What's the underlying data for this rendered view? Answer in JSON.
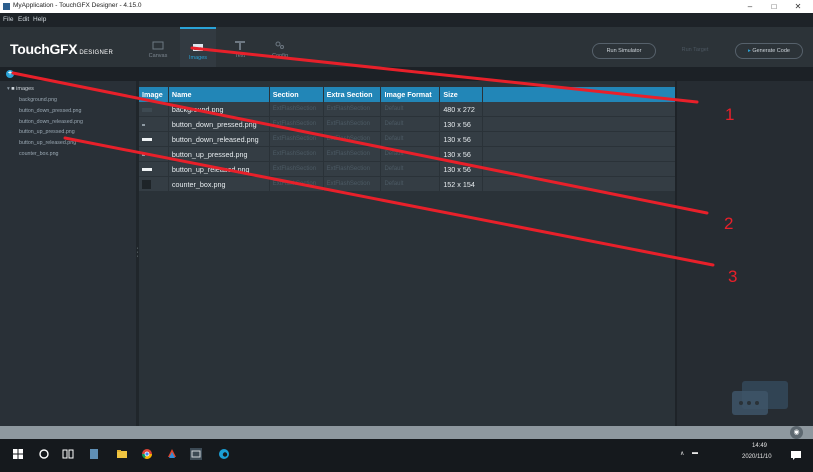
{
  "window": {
    "title": "MyApplication - TouchGFX Designer - 4.15.0",
    "controls": [
      "–",
      "□",
      "✕"
    ]
  },
  "menu": [
    "File",
    "Edit",
    "Help"
  ],
  "header": {
    "logo_main": "TouchGFX",
    "logo_sub": "DESIGNER",
    "tabs": [
      {
        "label": "Canvas",
        "icon": "canvas-icon"
      },
      {
        "label": "Images",
        "icon": "image-icon"
      },
      {
        "label": "Text",
        "icon": "text-icon"
      },
      {
        "label": "Config",
        "icon": "config-icon"
      }
    ],
    "run_simulator": "Run Simulator",
    "run_target": "Run Target",
    "generate_code": "Generate Code"
  },
  "sidebar": {
    "root": "images",
    "items": [
      "background.png",
      "button_down_pressed.png",
      "button_down_released.png",
      "button_up_pressed.png",
      "button_up_released.png",
      "counter_box.png"
    ]
  },
  "table": {
    "headers": [
      "Image",
      "Name",
      "Section",
      "Extra Section",
      "Image Format",
      "Size"
    ],
    "rows": [
      {
        "thumb": "bg",
        "name": "background.png",
        "section": "ExtFlashSection",
        "extra": "ExtFlashSection",
        "format": "Default",
        "size": "480 x 272"
      },
      {
        "thumb": "small",
        "name": "button_down_pressed.png",
        "section": "ExtFlashSection",
        "extra": "ExtFlashSection",
        "format": "Default",
        "size": "130 x 56"
      },
      {
        "thumb": "bar",
        "name": "button_down_released.png",
        "section": "ExtFlashSection",
        "extra": "ExtFlashSection",
        "format": "Default",
        "size": "130 x 56"
      },
      {
        "thumb": "small",
        "name": "button_up_pressed.png",
        "section": "ExtFlashSection",
        "extra": "ExtFlashSection",
        "format": "Default",
        "size": "130 x 56"
      },
      {
        "thumb": "bar",
        "name": "button_up_released.png",
        "section": "ExtFlashSection",
        "extra": "ExtFlashSection",
        "format": "Default",
        "size": "130 x 56"
      },
      {
        "thumb": "box",
        "name": "counter_box.png",
        "section": "ExtFlashSection",
        "extra": "ExtFlashSection",
        "format": "Default",
        "size": "152 x 154"
      }
    ]
  },
  "annotations": [
    "1",
    "2",
    "3"
  ],
  "annotation_color": "#e8202a",
  "accent_color": "#2aa3d8",
  "taskbar": {
    "time": "14:49",
    "date": "2020/11/10"
  }
}
